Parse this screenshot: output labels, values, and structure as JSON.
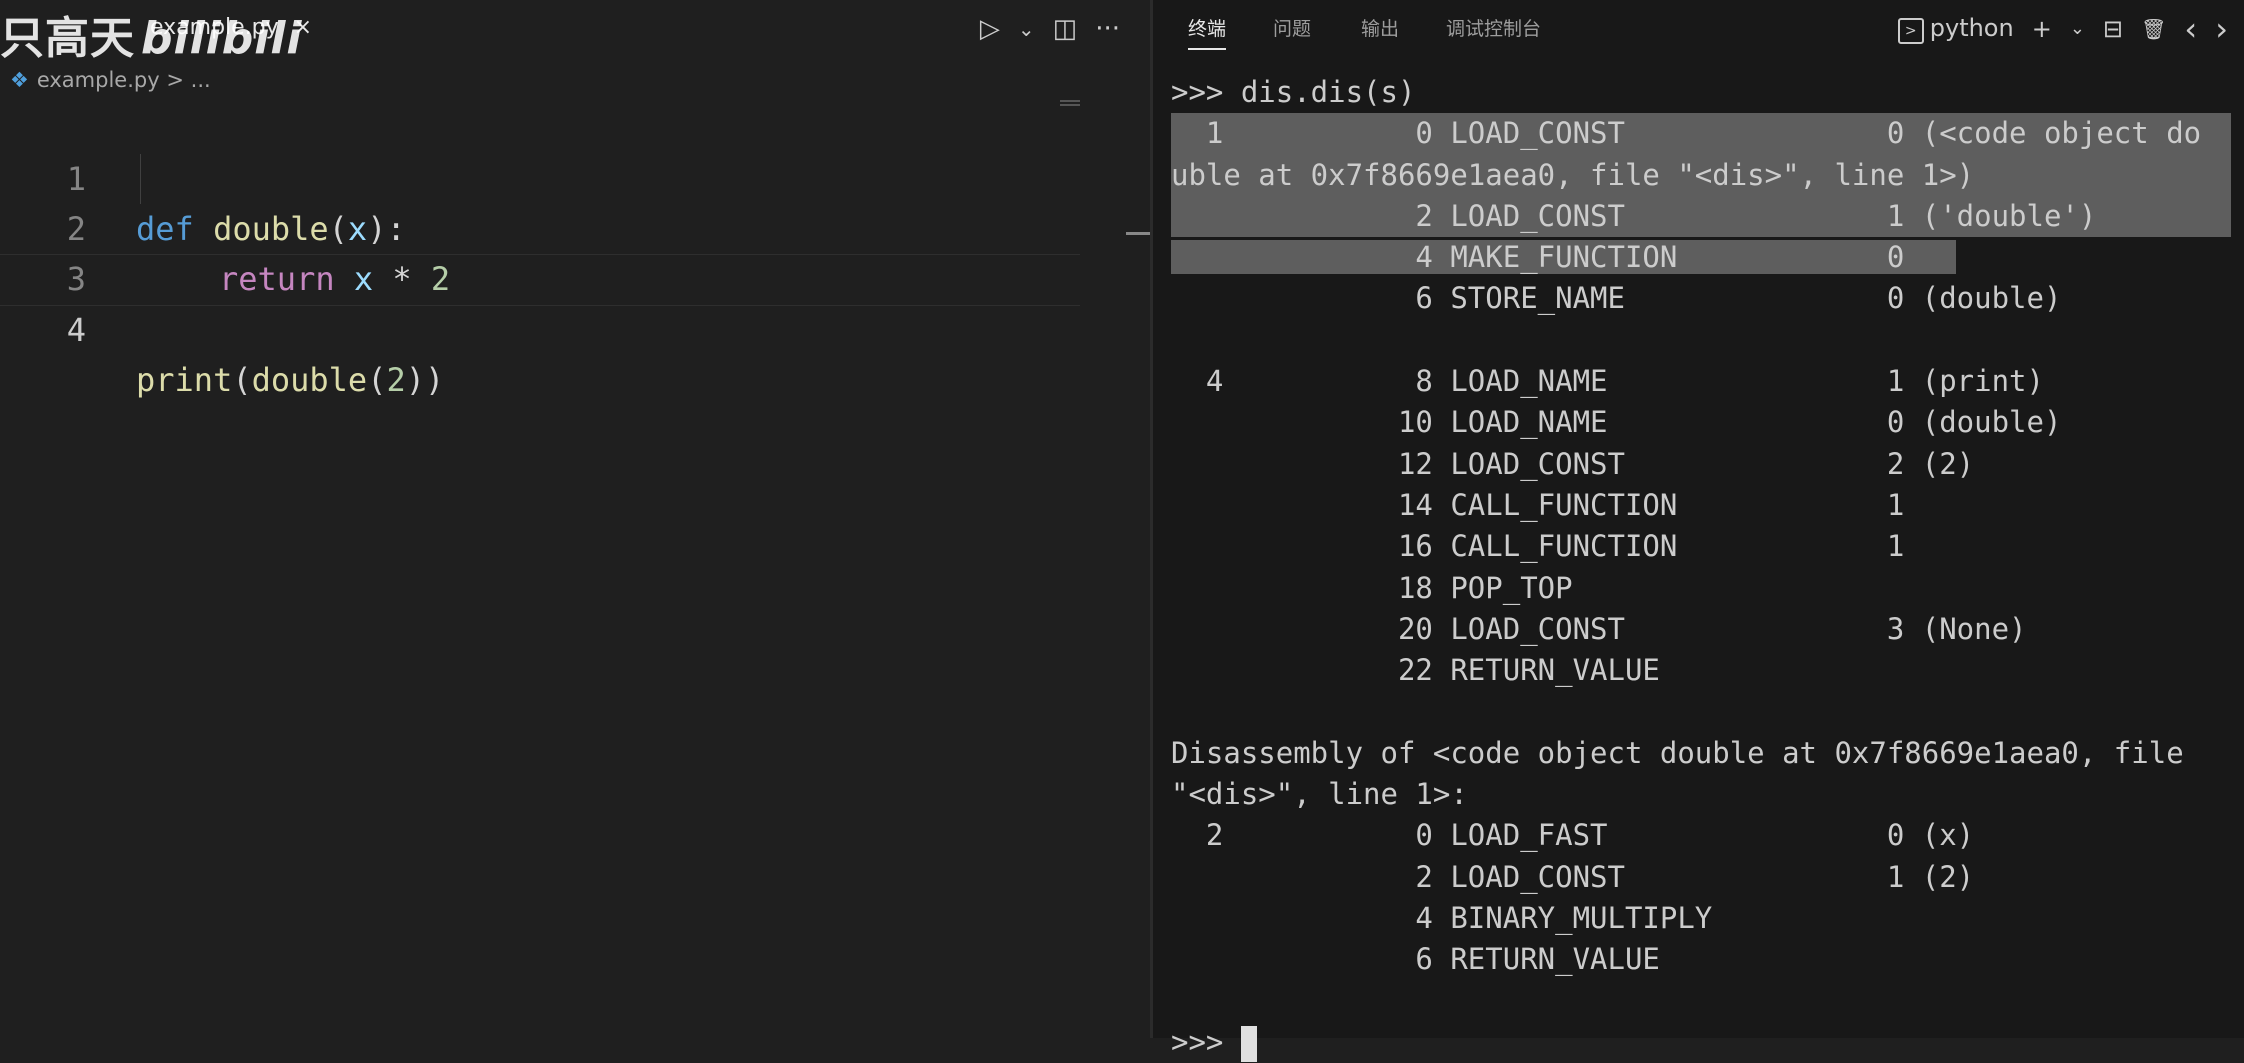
{
  "editor": {
    "tab_title": "example.py",
    "tab_close": "×",
    "watermark_text": "只高天",
    "watermark_logo": "bilibili",
    "breadcrumb_file": "example.py",
    "breadcrumb_sep": ">",
    "breadcrumb_more": "...",
    "actions": {
      "run": "▷",
      "run_dropdown": "⌄",
      "split": "◫",
      "more": "···"
    },
    "lines": [
      {
        "n": "1"
      },
      {
        "n": "2"
      },
      {
        "n": "3"
      },
      {
        "n": "4"
      }
    ],
    "code": {
      "l1_def": "def",
      "l1_name": "double",
      "l1_open": "(",
      "l1_param": "x",
      "l1_close": "):",
      "l2_return": "return",
      "l2_x": "x",
      "l2_op": " * ",
      "l2_num": "2",
      "l4_print": "print",
      "l4_open": "(",
      "l4_double": "double",
      "l4_open2": "(",
      "l4_num": "2",
      "l4_close": "))"
    }
  },
  "panel": {
    "tabs": [
      "终端",
      "问题",
      "输出",
      "调试控制台"
    ],
    "active_tab": "终端",
    "terminal_name": "python",
    "actions": {
      "add": "+",
      "add_dropdown": "⌄",
      "split": "⊟",
      "trash": "🗑",
      "prev": "‹",
      "next": "›"
    }
  },
  "terminal": {
    "lines": [
      ">>> dis.dis(s)",
      "  1           0 LOAD_CONST               0 (<code object do",
      "uble at 0x7f8669e1aea0, file \"<dis>\", line 1>)",
      "              2 LOAD_CONST               1 ('double')",
      "              4 MAKE_FUNCTION            0",
      "              6 STORE_NAME               0 (double)",
      "",
      "  4           8 LOAD_NAME                1 (print)",
      "             10 LOAD_NAME                0 (double)",
      "             12 LOAD_CONST               2 (2)",
      "             14 CALL_FUNCTION            1",
      "             16 CALL_FUNCTION            1",
      "             18 POP_TOP",
      "             20 LOAD_CONST               3 (None)",
      "             22 RETURN_VALUE",
      "",
      "Disassembly of <code object double at 0x7f8669e1aea0, file",
      "\"<dis>\", line 1>:",
      "  2           0 LOAD_FAST                0 (x)",
      "              2 LOAD_CONST               1 (2)",
      "              4 BINARY_MULTIPLY",
      "              6 RETURN_VALUE",
      "",
      ">>> "
    ]
  }
}
